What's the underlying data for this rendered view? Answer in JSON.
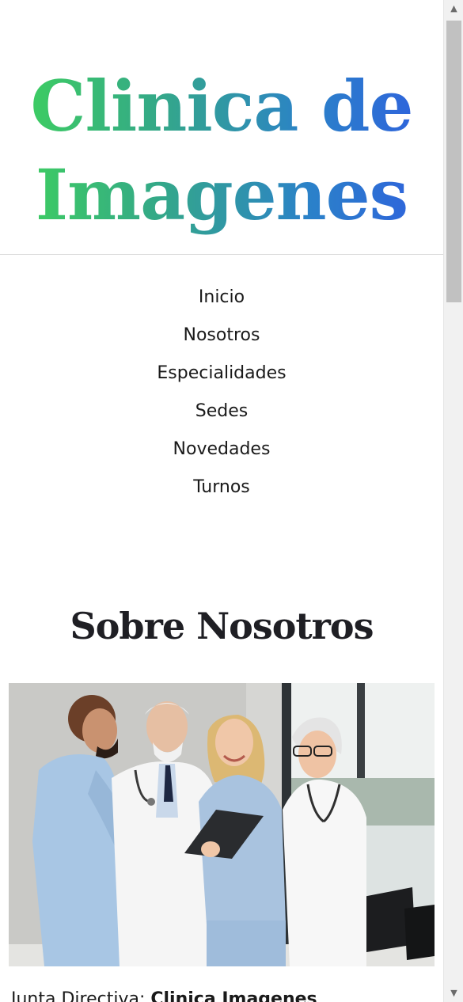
{
  "header": {
    "title_line1": "Clinica de",
    "title_line2": "Imagenes",
    "gradient_colors": [
      "#3fd45a",
      "#34a987",
      "#2b81c9",
      "#2f5de0"
    ]
  },
  "nav": {
    "items": [
      {
        "label": "Inicio"
      },
      {
        "label": "Nosotros"
      },
      {
        "label": "Especialidades"
      },
      {
        "label": "Sedes"
      },
      {
        "label": "Novedades"
      },
      {
        "label": "Turnos"
      }
    ]
  },
  "about": {
    "title": "Sobre Nosotros",
    "photo_alt": "medical-team-photo",
    "board_label": "Junta Directiva:",
    "board_value": "Clinica Imagenes"
  },
  "scrollbar": {
    "up_icon": "▲",
    "down_icon": "▼"
  }
}
